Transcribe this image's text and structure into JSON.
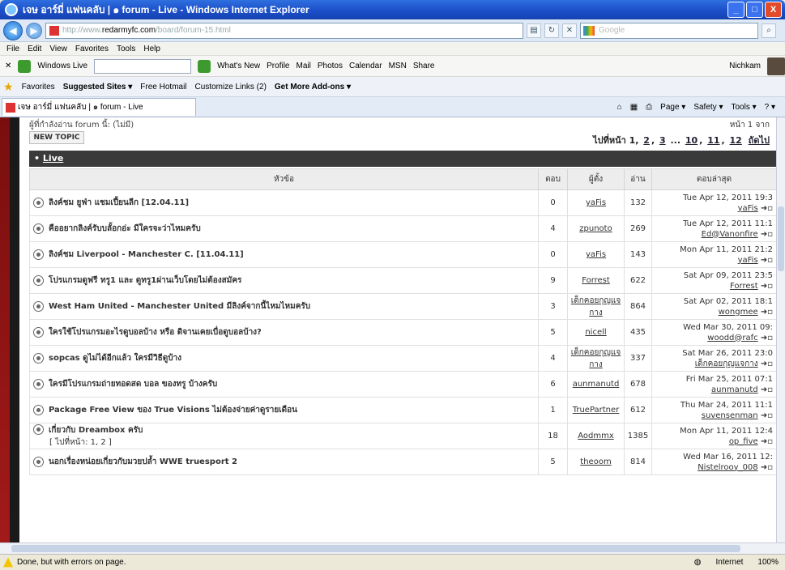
{
  "window": {
    "title": "เจษ อาร์มี่ แฟนคลับ | ๑ forum - Live - Windows Internet Explorer",
    "buttons": [
      "_",
      "□",
      "X"
    ]
  },
  "address": {
    "url_prefix": "http://www.",
    "domain": "redarmyfc.com",
    "url_suffix": "/board/forum-15.html",
    "search_placeholder": "Google"
  },
  "menu": [
    "File",
    "Edit",
    "View",
    "Favorites",
    "Tools",
    "Help"
  ],
  "wl_toolbar": {
    "brand": "Windows Live",
    "links": [
      "What's New",
      "Profile",
      "Mail",
      "Photos",
      "Calendar",
      "MSN",
      "Share"
    ],
    "user": "Nichkam"
  },
  "favorites": {
    "label": "Favorites",
    "items": [
      "Suggested Sites ▾",
      "Free Hotmail",
      "Customize Links (2)",
      "Get More Add-ons ▾"
    ]
  },
  "tab": {
    "title": "เจษ อาร์มี่ แฟนคลับ | ๑ forum - Live"
  },
  "commands": [
    "Page ▾",
    "Safety ▾",
    "Tools ▾",
    "? ▾"
  ],
  "forum": {
    "watchers": "ผู้ที่กำลังอ่าน forum นี้: (ไม่มี)",
    "page_of": "หน้า 1 จาก",
    "new_topic": "NEW TOPIC",
    "pager_label": "ไปที่หน้า",
    "pages": [
      "1",
      "2",
      "3",
      "...",
      "10",
      "11",
      "12",
      "ถัดไป"
    ],
    "category": "Live",
    "columns": {
      "topic": "หัวข้อ",
      "replies": "ตอบ",
      "author": "ผู้ตั้ง",
      "views": "อ่าน",
      "last": "ตอบล่าสุด"
    },
    "topics": [
      {
        "title": "ลิงค์ชม ยูฟ่า แชมเปี้ยนลีก [12.04.11]",
        "replies": "0",
        "author": "yaFis",
        "views": "132",
        "last_date": "Tue Apr 12, 2011 19:3",
        "last_by": "yaFis"
      },
      {
        "title": "คืออยากลิงค์รับบลั้อกอ่ะ มีใครจะว่าไหมครับ",
        "replies": "4",
        "author": "zpunoto",
        "views": "269",
        "last_date": "Tue Apr 12, 2011 11:1",
        "last_by": "Ed@Vanonfire"
      },
      {
        "title": "ลิงค์ชม Liverpool - Manchester C. [11.04.11]",
        "replies": "0",
        "author": "yaFis",
        "views": "143",
        "last_date": "Mon Apr 11, 2011 21:2",
        "last_by": "yaFis"
      },
      {
        "title": "โปรแกรมดูฟรี ทรู1 และ ดูทรู1ผ่านเว็บโดยไม่ต้องสมัคร",
        "replies": "9",
        "author": "Forrest",
        "views": "622",
        "last_date": "Sat Apr 09, 2011 23:5",
        "last_by": "Forrest"
      },
      {
        "title": "West Ham United - Manchester United มีลิงค์จากนี้ไหมไหมครับ",
        "replies": "3",
        "author": "เด็กคอยกุญแจกาง",
        "views": "864",
        "last_date": "Sat Apr 02, 2011 18:1",
        "last_by": "wongmee"
      },
      {
        "title": "ใครใช้โปรแกรมอะไรดูบอลบ้าง หรือ ดิจานเคยเบื่อดูบอลบ้าง?",
        "replies": "5",
        "author": "nicell",
        "views": "435",
        "last_date": "Wed Mar 30, 2011 09:",
        "last_by": "woodd@rafc"
      },
      {
        "title": "sopcas ดูไม่ได้อีกแล้ว ใครมีวิธีดูบ้าง",
        "replies": "4",
        "author": "เด็กคอยกุญแจกาง",
        "views": "337",
        "last_date": "Sat Mar 26, 2011 23:0",
        "last_by": "เด็กคอยกุญแจกาง"
      },
      {
        "title": "ใครมีโปรแกรมถ่ายทอดสด บอล ของทรู บ้างครับ",
        "replies": "6",
        "author": "aunmanutd",
        "views": "678",
        "last_date": "Fri Mar 25, 2011 07:1",
        "last_by": "aunmanutd"
      },
      {
        "title": "Package Free View ของ True Visions ไม่ต้องจ่ายค่าดูรายเดือน",
        "replies": "1",
        "author": "TruePartner",
        "views": "612",
        "last_date": "Thu Mar 24, 2011 11:1",
        "last_by": "suvensenman"
      },
      {
        "title": "เกี่ยวกับ Dreambox ครับ",
        "subpages": "[ ไปที่หน้า: 1, 2 ]",
        "replies": "18",
        "author": "Aodmmx",
        "views": "1385",
        "last_date": "Mon Apr 11, 2011 12:4",
        "last_by": "op_five"
      },
      {
        "title": "นอกเรื่องหน่อยเกี่ยวกับมวยปล้ำ WWE truesport 2",
        "replies": "5",
        "author": "theoom",
        "views": "814",
        "last_date": "Wed Mar 16, 2011 12:",
        "last_by": "Nistelrooy_008"
      }
    ]
  },
  "status": {
    "text": "Done, but with errors on page.",
    "zone": "Internet",
    "zoom": "100%"
  }
}
